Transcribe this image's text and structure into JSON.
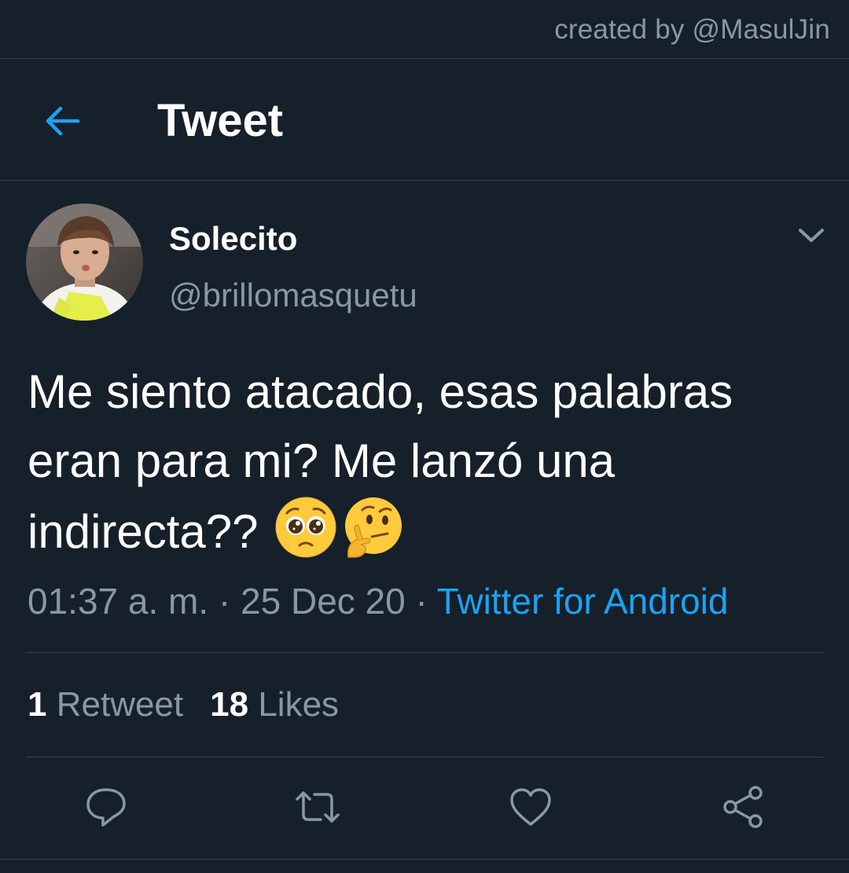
{
  "watermark": "created by @MasulJin",
  "header": {
    "back_icon": "arrow-left-icon",
    "title": "Tweet"
  },
  "tweet": {
    "author": {
      "display_name": "Solecito",
      "handle": "@brillomasquetu"
    },
    "text": "Me siento atacado, esas palabras eran para mi? Me lanzó una indirecta??",
    "emojis": [
      "pleading-face-emoji",
      "thinking-face-emoji"
    ],
    "meta": {
      "time": "01:37 a. m.",
      "separator": " · ",
      "date": "25 Dec 20",
      "source": "Twitter for Android"
    },
    "stats": {
      "retweets_count": "1",
      "retweets_label": "Retweet",
      "likes_count": "18",
      "likes_label": "Likes"
    },
    "actions": [
      "reply-icon",
      "retweet-icon",
      "like-icon",
      "share-icon"
    ]
  },
  "colors": {
    "background": "#15202b",
    "accent": "#1da1f2",
    "muted_text": "#8899a6",
    "divider": "#38444d"
  }
}
